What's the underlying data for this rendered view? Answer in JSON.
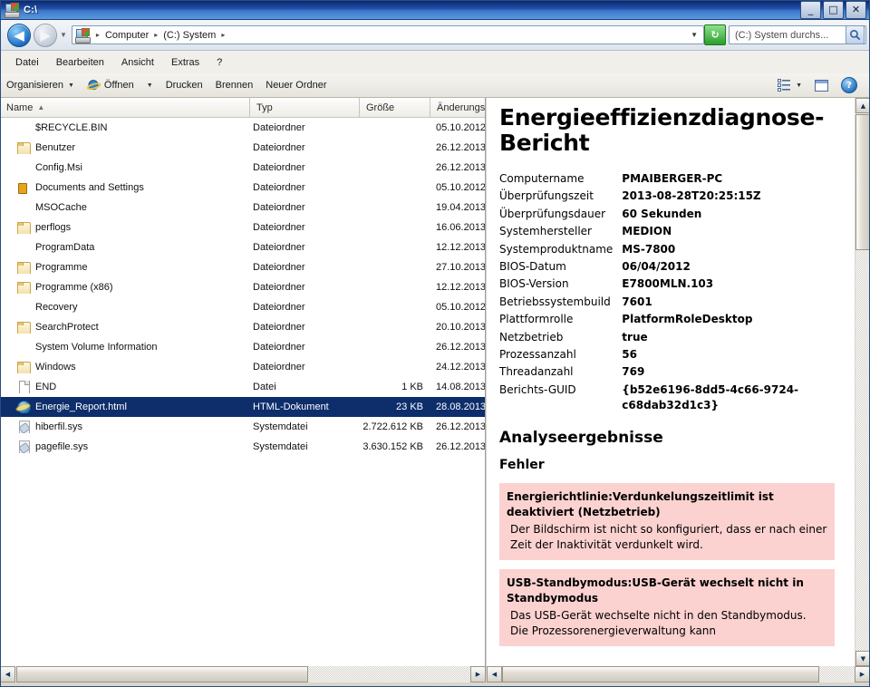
{
  "window": {
    "title": "C:\\",
    "icon": "computer-drive-icon",
    "minimize_label": "_",
    "maximize_label": "□",
    "close_label": "✕"
  },
  "navbar": {
    "back_label": "◀",
    "forward_label": "▶",
    "history_caret": "▼",
    "address_icon": "computer-drive-icon",
    "breadcrumbs": [
      "Computer",
      "(C:) System"
    ],
    "separator": "▸",
    "dropdown_caret": "▼",
    "refresh_label": "↻",
    "search_value": "(C:) System durchs...",
    "search_icon": "search-icon"
  },
  "menubar": {
    "items": [
      "Datei",
      "Bearbeiten",
      "Ansicht",
      "Extras",
      "?"
    ]
  },
  "toolbar": {
    "organize_label": "Organisieren",
    "organize_caret": "▼",
    "open_label": "Öffnen",
    "open_icon": "internet-explorer-icon",
    "open_caret": "▼",
    "print_label": "Drucken",
    "burn_label": "Brennen",
    "new_folder_label": "Neuer Ordner",
    "view_icon": "view-list-icon",
    "view_caret": "▼",
    "preview_pane_icon": "preview-pane-icon",
    "help_icon": "help-icon",
    "help_label": "?"
  },
  "filelist": {
    "columns": [
      {
        "label": "Name",
        "sort": "▲"
      },
      {
        "label": "Typ",
        "sort": ""
      },
      {
        "label": "Größe",
        "sort": ""
      },
      {
        "label": "Änderungs",
        "sort": ""
      }
    ],
    "rows": [
      {
        "name": "$RECYCLE.BIN",
        "icon": "folder-light",
        "type": "Dateiordner",
        "size": "",
        "date": "05.10.2012",
        "selected": false
      },
      {
        "name": "Benutzer",
        "icon": "folder",
        "type": "Dateiordner",
        "size": "",
        "date": "26.12.2013",
        "selected": false
      },
      {
        "name": "Config.Msi",
        "icon": "folder-light",
        "type": "Dateiordner",
        "size": "",
        "date": "26.12.2013",
        "selected": false
      },
      {
        "name": "Documents and Settings",
        "icon": "locked",
        "type": "Dateiordner",
        "size": "",
        "date": "05.10.2012",
        "selected": false
      },
      {
        "name": "MSOCache",
        "icon": "folder-light",
        "type": "Dateiordner",
        "size": "",
        "date": "19.04.2013",
        "selected": false
      },
      {
        "name": "perflogs",
        "icon": "folder",
        "type": "Dateiordner",
        "size": "",
        "date": "16.06.2013",
        "selected": false
      },
      {
        "name": "ProgramData",
        "icon": "folder-light",
        "type": "Dateiordner",
        "size": "",
        "date": "12.12.2013",
        "selected": false
      },
      {
        "name": "Programme",
        "icon": "folder",
        "type": "Dateiordner",
        "size": "",
        "date": "27.10.2013",
        "selected": false
      },
      {
        "name": "Programme (x86)",
        "icon": "folder",
        "type": "Dateiordner",
        "size": "",
        "date": "12.12.2013",
        "selected": false
      },
      {
        "name": "Recovery",
        "icon": "folder-light",
        "type": "Dateiordner",
        "size": "",
        "date": "05.10.2012",
        "selected": false
      },
      {
        "name": "SearchProtect",
        "icon": "folder",
        "type": "Dateiordner",
        "size": "",
        "date": "20.10.2013",
        "selected": false
      },
      {
        "name": "System Volume Information",
        "icon": "folder-light",
        "type": "Dateiordner",
        "size": "",
        "date": "26.12.2013",
        "selected": false
      },
      {
        "name": "Windows",
        "icon": "folder",
        "type": "Dateiordner",
        "size": "",
        "date": "24.12.2013",
        "selected": false
      },
      {
        "name": "END",
        "icon": "file",
        "type": "Datei",
        "size": "1 KB",
        "date": "14.08.2013",
        "selected": false
      },
      {
        "name": "Energie_Report.html",
        "icon": "html",
        "type": "HTML-Dokument",
        "size": "23 KB",
        "date": "28.08.2013",
        "selected": true
      },
      {
        "name": "hiberfil.sys",
        "icon": "sys",
        "type": "Systemdatei",
        "size": "2.722.612 KB",
        "date": "26.12.2013",
        "selected": false
      },
      {
        "name": "pagefile.sys",
        "icon": "sys",
        "type": "Systemdatei",
        "size": "3.630.152 KB",
        "date": "26.12.2013",
        "selected": false
      }
    ]
  },
  "preview": {
    "title": "Energieeffizienzdiagnose-Bericht",
    "system_info": [
      {
        "key": "Computername",
        "value": "PMAIBERGER-PC"
      },
      {
        "key": "Überprüfungszeit",
        "value": "2013-08-28T20:25:15Z"
      },
      {
        "key": "Überprüfungsdauer",
        "value": "60 Sekunden"
      },
      {
        "key": "Systemhersteller",
        "value": "MEDION"
      },
      {
        "key": "Systemproduktname",
        "value": "MS-7800"
      },
      {
        "key": "BIOS-Datum",
        "value": "06/04/2012"
      },
      {
        "key": "BIOS-Version",
        "value": "E7800MLN.103"
      },
      {
        "key": "Betriebssystembuild",
        "value": "7601"
      },
      {
        "key": "Plattformrolle",
        "value": "PlatformRoleDesktop"
      },
      {
        "key": "Netzbetrieb",
        "value": "true"
      },
      {
        "key": "Prozessanzahl",
        "value": "56"
      },
      {
        "key": "Threadanzahl",
        "value": "769"
      },
      {
        "key": "Berichts-GUID",
        "value": "{b52e6196-8dd5-4c66-9724-c68dab32d1c3}"
      }
    ],
    "results_heading": "Analyseergebnisse",
    "errors_heading": "Fehler",
    "errors": [
      {
        "title": "Energierichtlinie:Verdunkelungszeitlimit ist deaktiviert (Netzbetrieb)",
        "description": "Der Bildschirm ist nicht so konfiguriert, dass er nach einer Zeit der Inaktivität verdunkelt wird."
      },
      {
        "title": "USB-Standbymodus:USB-Gerät wechselt nicht in Standbymodus",
        "description": "Das USB-Gerät wechselte nicht in den Standbymodus. Die Prozessorenergieverwaltung kann"
      }
    ],
    "error_background": "#fbd2d0"
  },
  "scrollbars": {
    "up_arrow": "▲",
    "down_arrow": "▼",
    "left_arrow": "◀",
    "right_arrow": "▶"
  }
}
